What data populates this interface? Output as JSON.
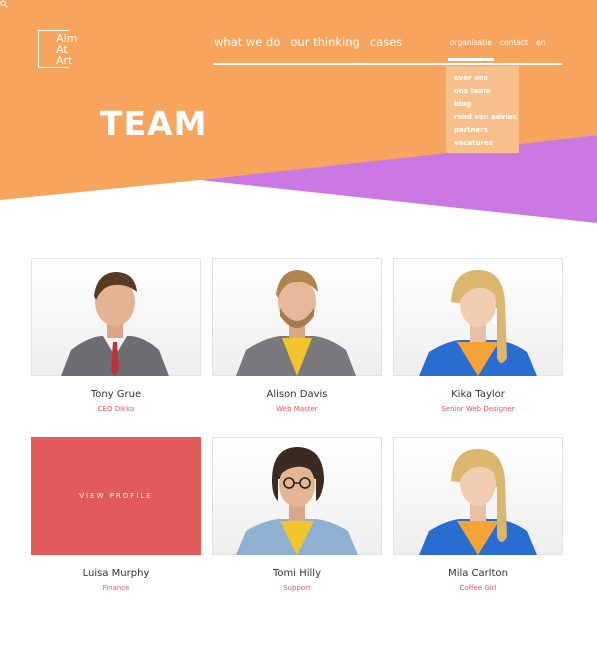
{
  "brand": {
    "logo_lines": [
      "Aim",
      "At",
      "Art"
    ]
  },
  "nav": {
    "main": [
      "what we do",
      "our thinking",
      "cases"
    ],
    "secondary": [
      "organisatie",
      "contact",
      "en"
    ],
    "search_icon": "search-icon"
  },
  "dropdown": {
    "items": [
      "over ons",
      "ons team",
      "blog",
      "raad van advies",
      "partners",
      "vacatures"
    ]
  },
  "hero": {
    "title": "TEAM"
  },
  "colors": {
    "orange": "#f7a45e",
    "violet": "#cc78e2",
    "accent_red": "#e25a5a"
  },
  "team": [
    {
      "name": "Tony Grue",
      "role": "CEO Dikka"
    },
    {
      "name": "Alison Davis",
      "role": "Web Master"
    },
    {
      "name": "Kika Taylor",
      "role": "Senior Web Designer"
    },
    {
      "name": "Luisa Murphy",
      "role": "Finance",
      "overlay": "VIEW PROFILE"
    },
    {
      "name": "Tomi Hilly",
      "role": "Support"
    },
    {
      "name": "Mila Carlton",
      "role": "Coffee Girl"
    }
  ]
}
